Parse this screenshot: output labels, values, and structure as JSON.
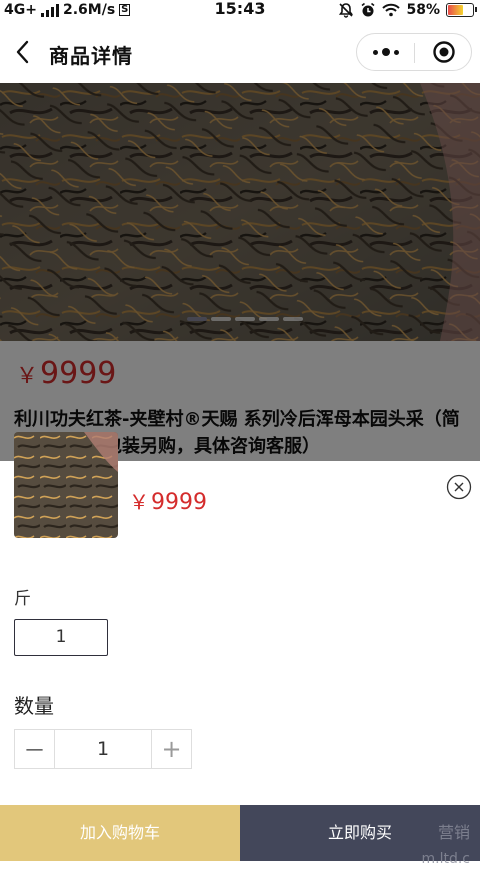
{
  "status_bar": {
    "network": "4G+",
    "speed": "2.6M/s",
    "s_badge": "S",
    "time": "15:43",
    "battery": "58%"
  },
  "nav": {
    "title": "商品详情",
    "icons": [
      "back-arrow-icon",
      "more-icon",
      "close-target-icon"
    ]
  },
  "product": {
    "currency": "￥",
    "price": "9999",
    "title": "利川功夫红茶-夹壁村®天赐 系列冷后浑母本园头采（简朴包装，精包装另购，具体咨询客服）",
    "carousel_active_index": 0
  },
  "sheet": {
    "currency": "￥",
    "price": "9999",
    "spec_label": "斤",
    "spec_option": "1",
    "qty_label": "数量",
    "qty_value": "1",
    "minus": "—",
    "plus": "+"
  },
  "bottom": {
    "add_to_cart": "加入购物车",
    "buy_now": "立即购买",
    "watermark_1": "营销",
    "watermark_2": "m.ltd.c"
  },
  "colors": {
    "price_red": "#d42c2c",
    "cart_button": "#e2c77b",
    "buy_button": "#43475a"
  }
}
